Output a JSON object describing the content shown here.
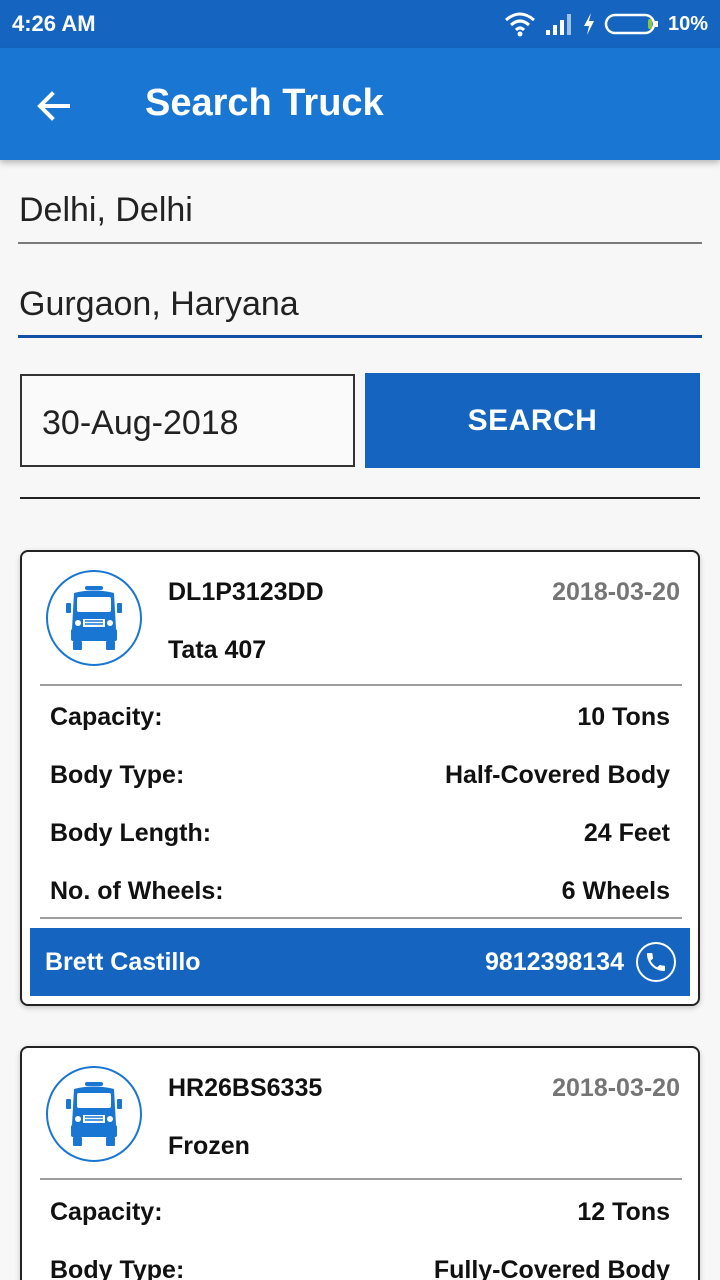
{
  "status_bar": {
    "time": "4:26 AM",
    "battery": "10%"
  },
  "app_bar": {
    "title": "Search Truck",
    "back_icon": "arrow-left-icon"
  },
  "search_form": {
    "from": "Delhi, Delhi",
    "to": "Gurgaon, Haryana",
    "date": "30-Aug-2018",
    "search_label": "SEARCH"
  },
  "results": [
    {
      "truck_no": "DL1P3123DD",
      "model": "Tata 407",
      "date": "2018-03-20",
      "capacity_label": "Capacity:",
      "capacity": "10 Tons",
      "body_type_label": "Body Type:",
      "body_type": "Half-Covered Body",
      "body_length_label": "Body Length:",
      "body_length": "24 Feet",
      "wheels_label": "No. of Wheels:",
      "wheels": "6 Wheels",
      "owner": "Brett Castillo",
      "phone": "9812398134"
    },
    {
      "truck_no": "HR26BS6335",
      "model": "Frozen",
      "date": "2018-03-20",
      "capacity_label": "Capacity:",
      "capacity": "12 Tons",
      "body_type_label": "Body Type:",
      "body_type": "Fully-Covered Body"
    }
  ],
  "colors": {
    "primary": "#1976d2",
    "primary_dark": "#1565c0",
    "accent_line": "#1250a5"
  }
}
